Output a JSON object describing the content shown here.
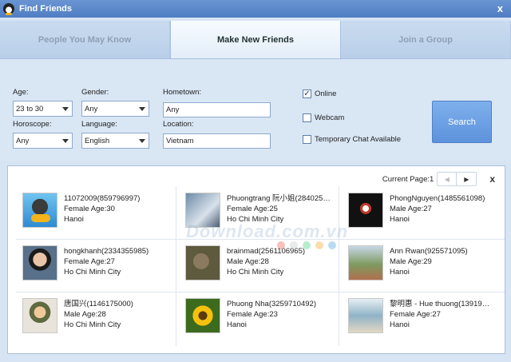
{
  "window": {
    "title": "Find Friends",
    "close_glyph": "x",
    "icon": "qq-penguin-icon"
  },
  "tabs": [
    {
      "label": "People You May Know",
      "active": false
    },
    {
      "label": "Make New Friends",
      "active": true
    },
    {
      "label": "Join a Group",
      "active": false
    }
  ],
  "form": {
    "age_label": "Age:",
    "age_value": "23 to 30",
    "gender_label": "Gender:",
    "gender_value": "Any",
    "hometown_label": "Hometown:",
    "hometown_value": "Any",
    "horoscope_label": "Horoscope:",
    "horoscope_value": "Any",
    "language_label": "Language:",
    "language_value": "English",
    "location_label": "Location:",
    "location_value": "Vietnam",
    "online_label": "Online",
    "online_checked": true,
    "webcam_label": "Webcam",
    "webcam_checked": false,
    "temp_chat_label": "Temporary Chat Available",
    "temp_chat_checked": false,
    "search_label": "Search"
  },
  "pager": {
    "label": "Current Page:",
    "page": "1",
    "prev_glyph": "◀",
    "next_glyph": "▶",
    "close_glyph": "x"
  },
  "results": [
    {
      "name": "11072009(859796997)",
      "details": "Female  Age:30",
      "city": "Hanoi",
      "avatar": "qq-penguin"
    },
    {
      "name": "Phuongtrang 阮小姐(284025…",
      "details": "Female  Age:25",
      "city": "Ho Chi Minh City",
      "avatar": "doll"
    },
    {
      "name": "PhongNguyen(1485561098)",
      "details": "Male  Age:27",
      "city": "Hanoi",
      "avatar": "dark-mask"
    },
    {
      "name": "hongkhanh(2334355985)",
      "details": "Female  Age:27",
      "city": "Ho Chi Minh City",
      "avatar": "boy"
    },
    {
      "name": "brainmad(2561106965)",
      "details": "Male  Age:28",
      "city": "Ho Chi Minh City",
      "avatar": "cat"
    },
    {
      "name": "Ann Rwan(925571095)",
      "details": "Male  Age:29",
      "city": "Hanoi",
      "avatar": "street"
    },
    {
      "name": "唐国兴(1146175000)",
      "details": "Male  Age:28",
      "city": "Ho Chi Minh City",
      "avatar": "soldier"
    },
    {
      "name": "Phuong Nha(3259710492)",
      "details": "Female  Age:23",
      "city": "Hanoi",
      "avatar": "sunflower"
    },
    {
      "name": "黎明惠 - Hue thuong(13919…",
      "details": "Female  Age:27",
      "city": "Hanoi",
      "avatar": "girl"
    }
  ],
  "watermark": "Download.com.vn",
  "colors": {
    "accent": "#5d92dc",
    "titlebar": "#5a88c9",
    "dots": [
      "#e74c3c",
      "#bdc3c7",
      "#2ecc71",
      "#f39c12",
      "#3498db"
    ]
  }
}
